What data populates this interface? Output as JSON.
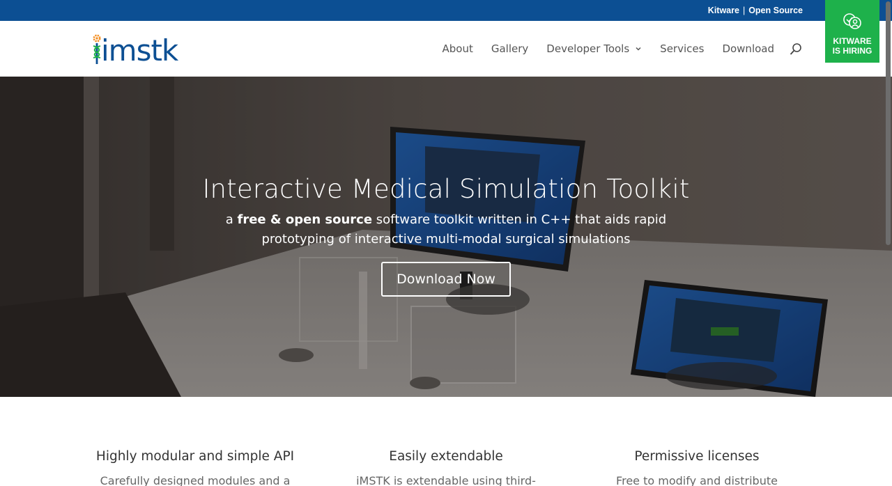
{
  "topbar": {
    "kitware_link": "Kitware",
    "separator": "|",
    "open_source_link": "Open Source"
  },
  "hiring": {
    "line1": "KITWARE",
    "line2": "IS HIRING",
    "icon": "people-chat-icon",
    "color": "#1eb14b"
  },
  "brand": {
    "logo_text": "imstk",
    "primary_color": "#0c4f93"
  },
  "nav": {
    "items": [
      {
        "label": "About"
      },
      {
        "label": "Gallery"
      },
      {
        "label": "Developer Tools",
        "has_dropdown": true
      },
      {
        "label": "Services"
      },
      {
        "label": "Download"
      }
    ],
    "search_icon": "search-icon"
  },
  "hero": {
    "title": "Interactive Medical Simulation Toolkit",
    "subtitle_prefix": "a ",
    "subtitle_bold": "free & open source",
    "subtitle_rest": " software toolkit written in C++ that aids rapid prototyping of interactive multi-modal surgical simulations",
    "button_label": "Download Now"
  },
  "features": [
    {
      "title": "Highly modular and simple API",
      "text": "Carefully designed modules and a"
    },
    {
      "title": "Easily extendable",
      "text": "iMSTK is extendable using third-party"
    },
    {
      "title": "Permissive licenses",
      "text": "Free to modify and distribute (including"
    }
  ]
}
